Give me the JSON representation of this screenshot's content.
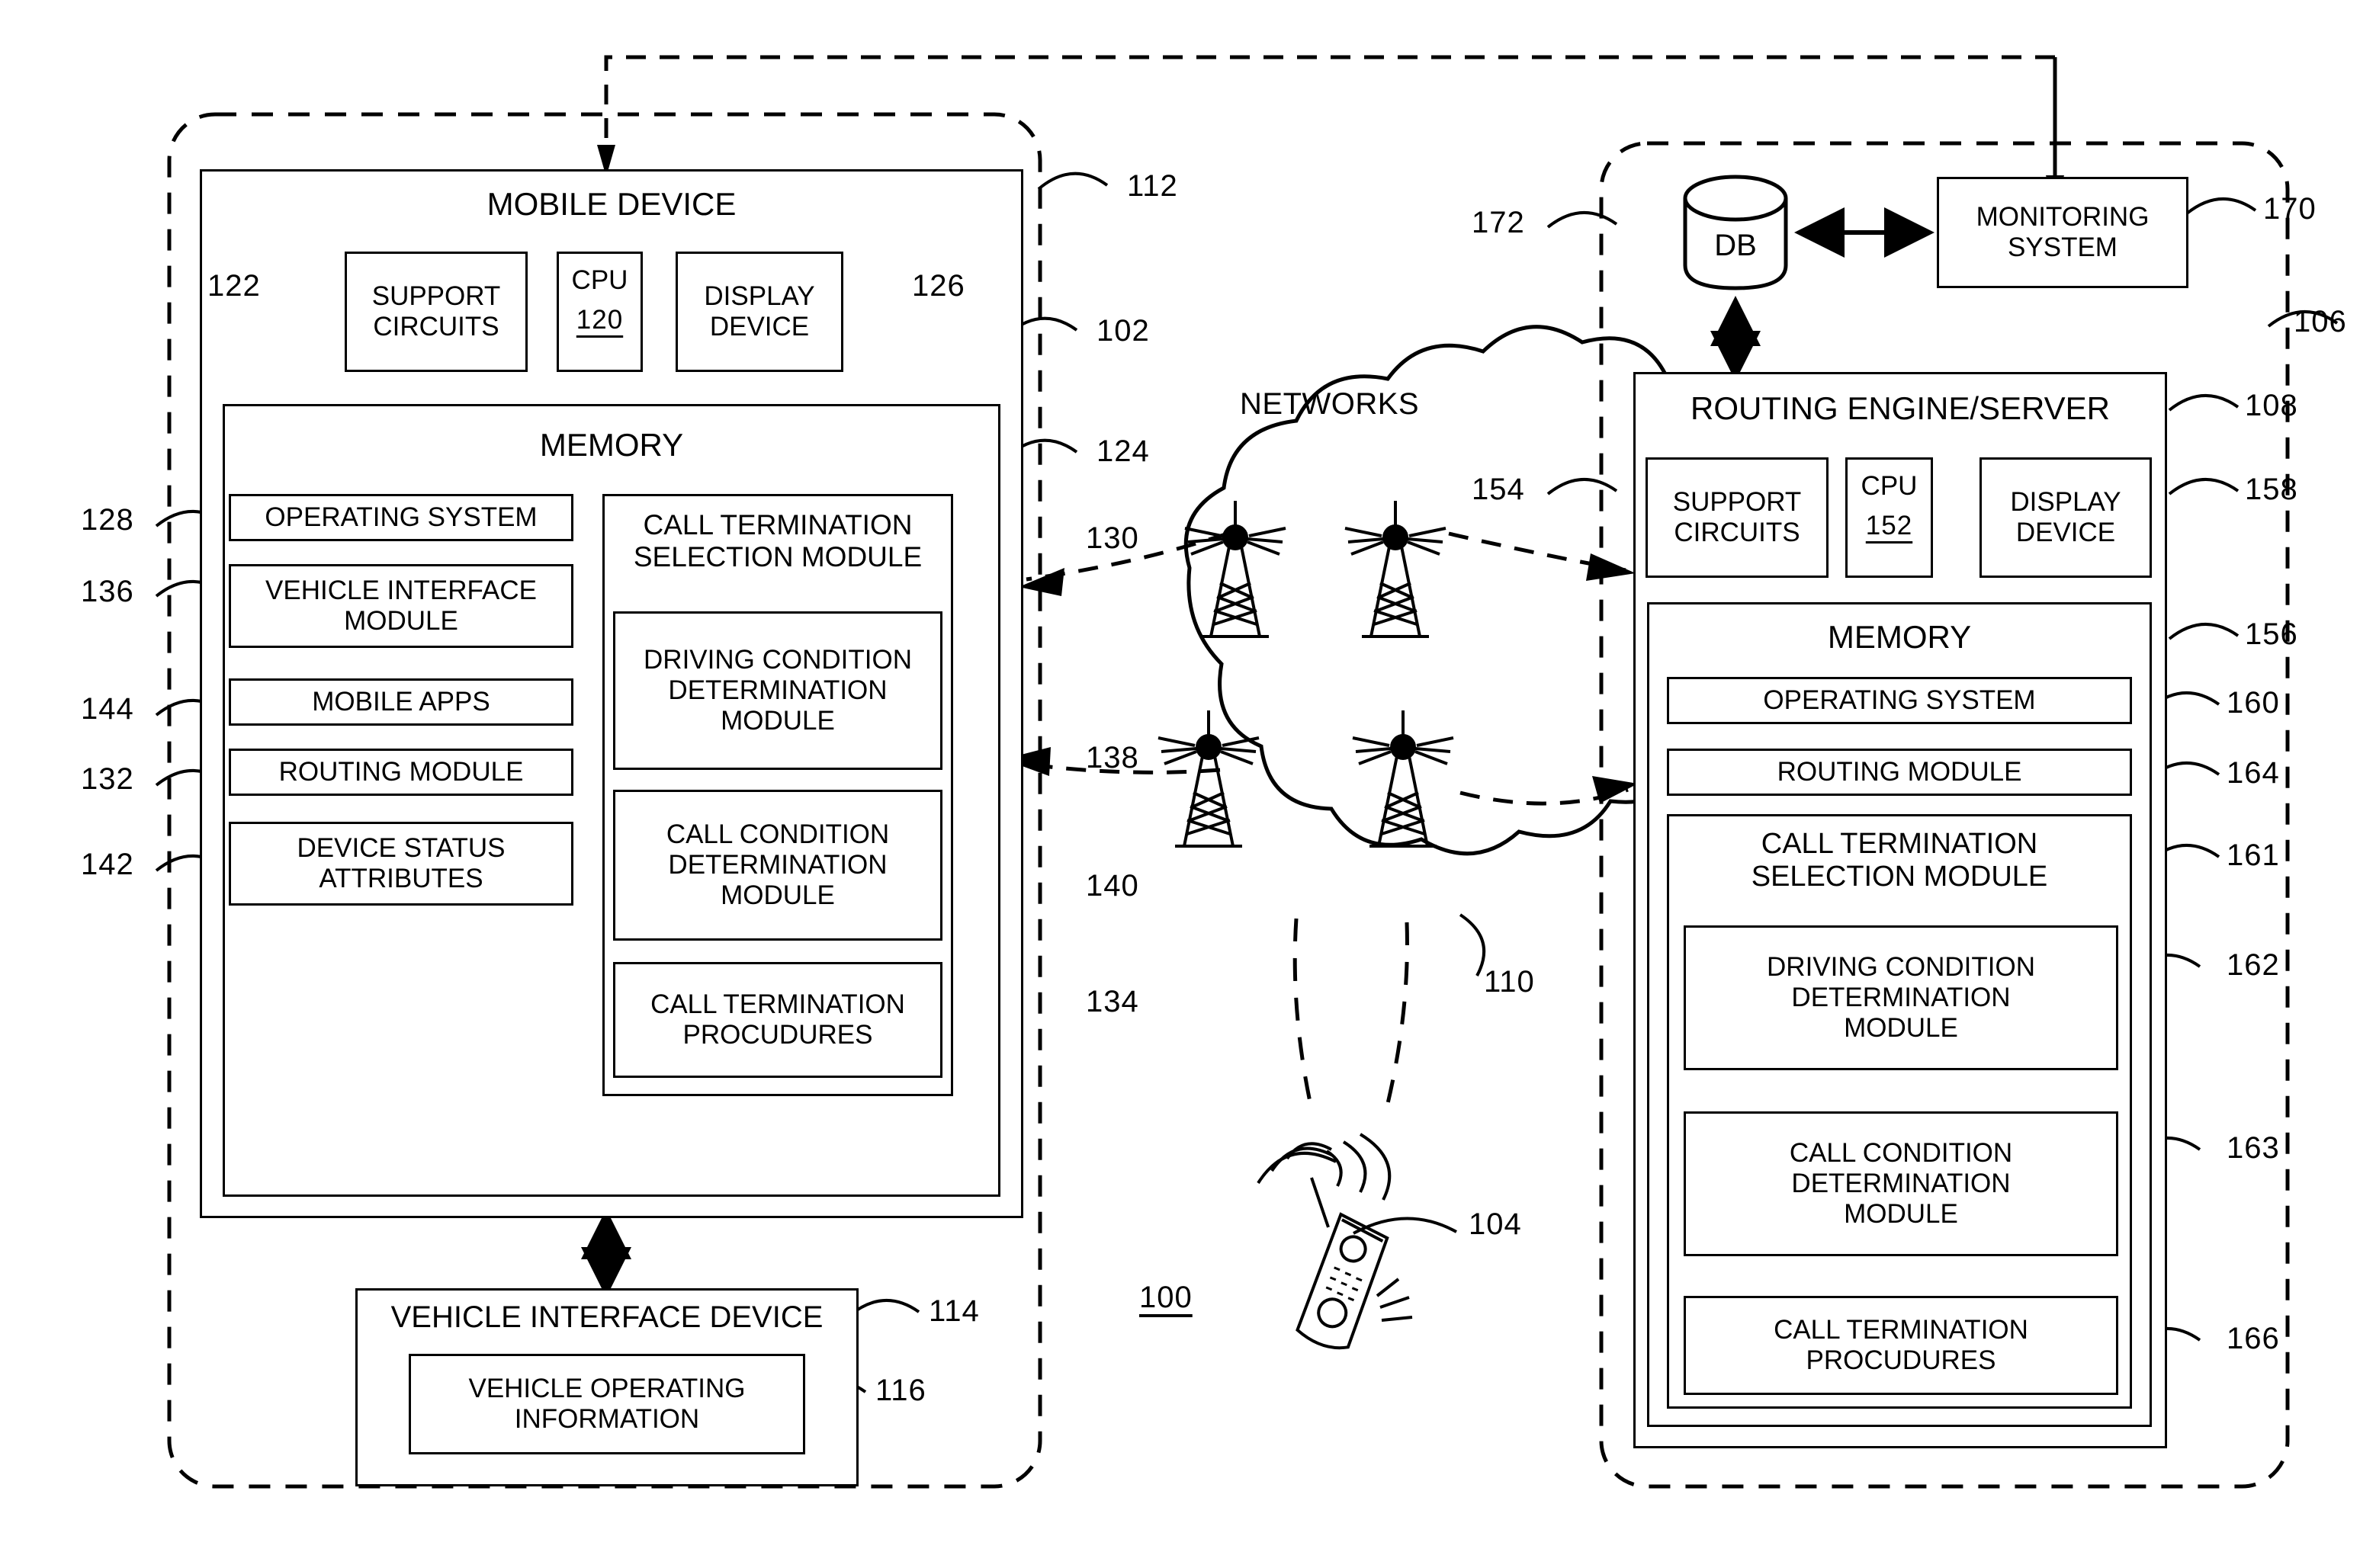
{
  "figure": {
    "figure_number": "100",
    "type": "patent-block-diagram"
  },
  "left_system": {
    "ref": "102",
    "outer_ref": "112",
    "device": {
      "title": "MOBILE DEVICE",
      "hardware": [
        {
          "label": "SUPPORT\nCIRCUITS",
          "ref": "122"
        },
        {
          "label": "CPU",
          "sub": "120",
          "ref": "120"
        },
        {
          "label": "DISPLAY\nDEVICE",
          "ref": "126"
        }
      ],
      "memory": {
        "title": "MEMORY",
        "ref": "124",
        "left_items": [
          {
            "label": "OPERATING SYSTEM",
            "ref": "128"
          },
          {
            "label": "VEHICLE INTERFACE\nMODULE",
            "ref": "136"
          },
          {
            "label": "MOBILE APPS",
            "ref": "144"
          },
          {
            "label": "ROUTING MODULE",
            "ref": "132"
          },
          {
            "label": "DEVICE STATUS\nATTRIBUTES",
            "ref": "142"
          }
        ],
        "selection_module": {
          "title": "CALL TERMINATION\nSELECTION MODULE",
          "ref": "130",
          "children": [
            {
              "label": "DRIVING CONDITION\nDETERMINATION\nMODULE",
              "ref": "138"
            },
            {
              "label": "CALL CONDITION\nDETERMINATION\nMODULE",
              "ref": "140"
            },
            {
              "label": "CALL TERMINATION\nPROCUDURES",
              "ref": "134"
            }
          ]
        }
      }
    },
    "vehicle_interface_device": {
      "title": "VEHICLE INTERFACE DEVICE",
      "ref": "114",
      "child": {
        "label": "VEHICLE OPERATING\nINFORMATION",
        "ref": "116"
      }
    }
  },
  "networks": {
    "title": "NETWORKS",
    "ref": "110",
    "tower_count": 4,
    "handset": {
      "ref": "104"
    }
  },
  "right_system": {
    "ref": "106",
    "database": {
      "label": "DB",
      "ref": "172"
    },
    "monitoring_system": {
      "label": "MONITORING\nSYSTEM",
      "ref": "170"
    },
    "server": {
      "title": "ROUTING ENGINE/SERVER",
      "ref": "108",
      "hardware": [
        {
          "label": "SUPPORT\nCIRCUITS",
          "ref": "154"
        },
        {
          "label": "CPU",
          "sub": "152",
          "ref": "152"
        },
        {
          "label": "DISPLAY\nDEVICE",
          "ref": "158"
        }
      ],
      "memory": {
        "title": "MEMORY",
        "ref": "156",
        "items": [
          {
            "label": "OPERATING SYSTEM",
            "ref": "160"
          },
          {
            "label": "ROUTING MODULE",
            "ref": "164"
          }
        ],
        "selection_module": {
          "title": "CALL TERMINATION\nSELECTION MODULE",
          "ref": "161",
          "children": [
            {
              "label": "DRIVING CONDITION\nDETERMINATION\nMODULE",
              "ref": "162"
            },
            {
              "label": "CALL CONDITION\nDETERMINATION\nMODULE",
              "ref": "163"
            },
            {
              "label": "CALL TERMINATION\nPROCUDURES",
              "ref": "166"
            }
          ]
        }
      }
    }
  }
}
